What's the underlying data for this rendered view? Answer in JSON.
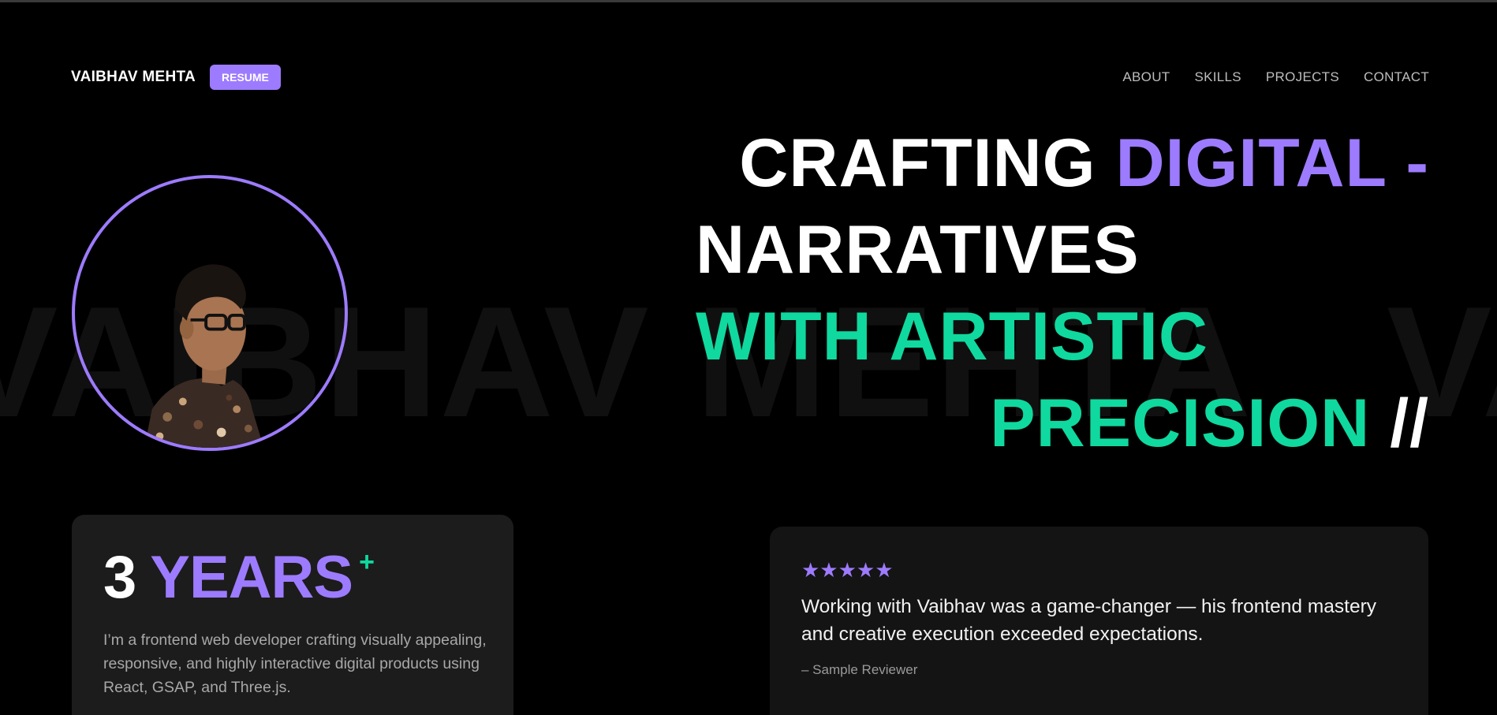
{
  "header": {
    "brand": "VAIBHAV MEHTA",
    "resume_label": "RESUME",
    "nav": [
      "ABOUT",
      "SKILLS",
      "PROJECTS",
      "CONTACT"
    ]
  },
  "background_marquee": [
    "VAIBHAV MEHTA",
    "VAIBHAV"
  ],
  "hero": {
    "line1_white": "CRAFTING",
    "line1_purple": "DIGITAL -",
    "line2_white": "NARRATIVES",
    "line3_green": "WITH ARTISTIC",
    "line4_green": "PRECISION",
    "line4_white": "//"
  },
  "stats": {
    "number": "3",
    "unit": "YEARS",
    "plus": "+",
    "description": "I’m a frontend web developer crafting visually appealing, responsive, and highly interactive digital products using React, GSAP, and Three.js."
  },
  "testimonial": {
    "stars": "★★★★★",
    "rating": 5,
    "quote": "Working with Vaibhav was a game-changer — his frontend mastery and creative execution exceeded expectations.",
    "reviewer": "– Sample Reviewer"
  },
  "colors": {
    "accent_purple": "#9d7bff",
    "accent_green": "#0fd99e",
    "background": "#000000",
    "card_bg": "#1c1c1c"
  }
}
